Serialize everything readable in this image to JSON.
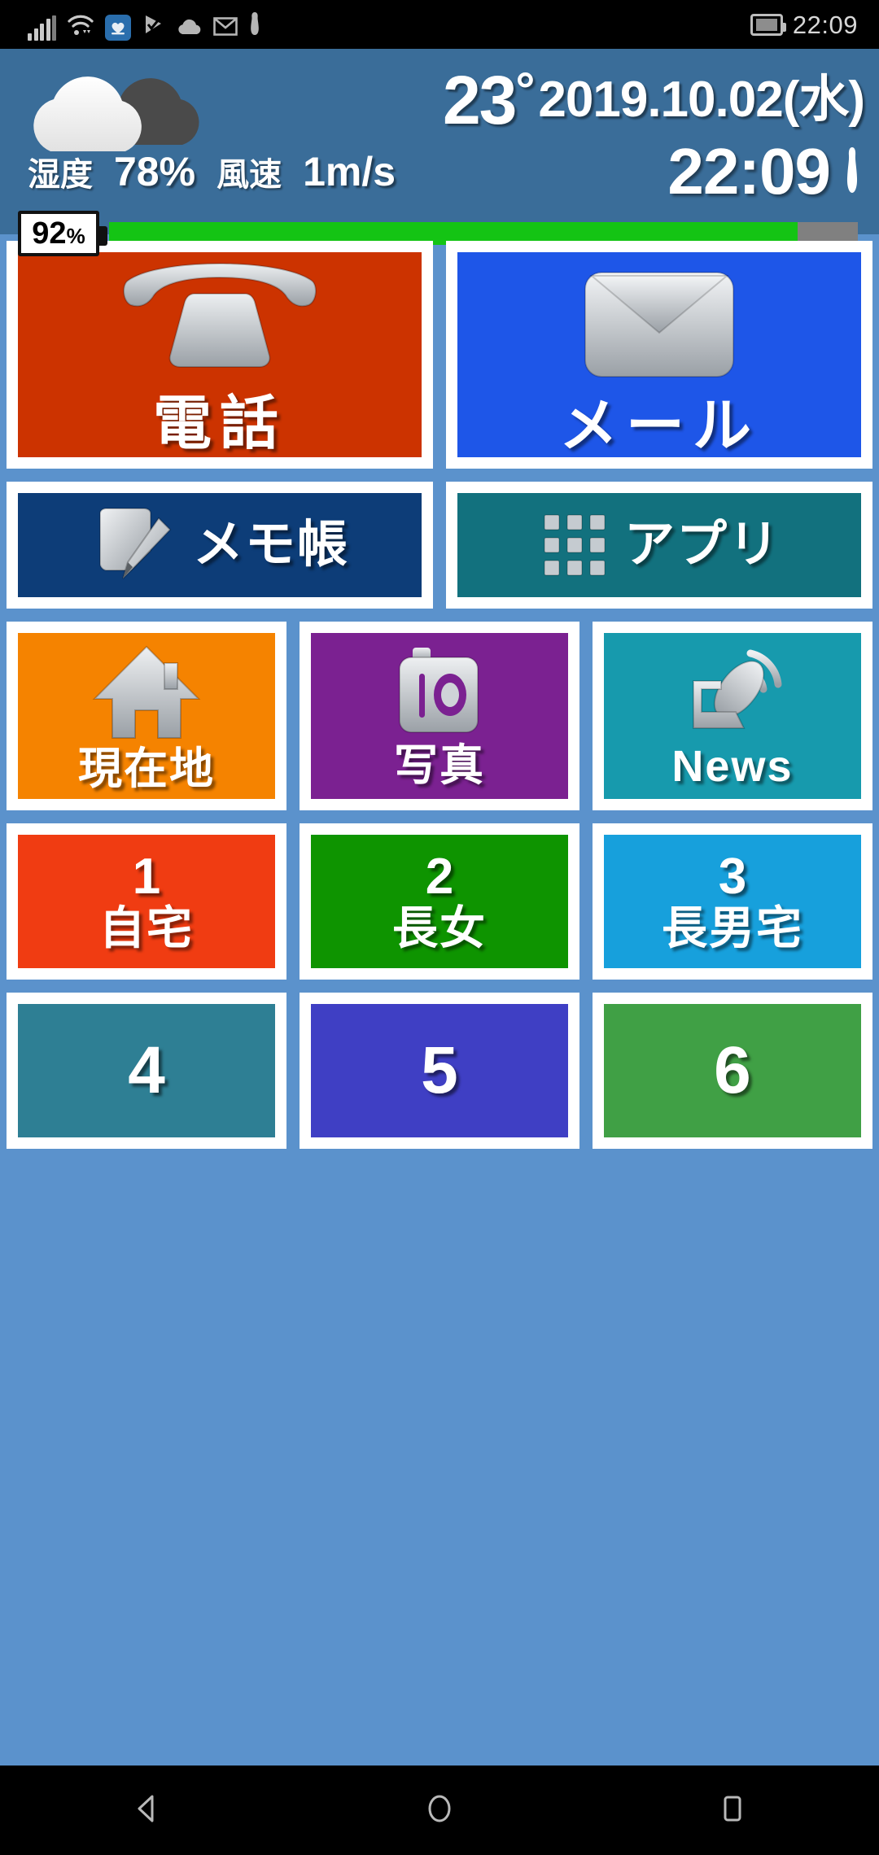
{
  "statusbar": {
    "time": "22:09",
    "icons": [
      "signal-bars-icon",
      "wifi-icon",
      "app-notification-icon",
      "play-store-icon",
      "cloud-icon",
      "email-icon",
      "person-icon"
    ],
    "battery_icon": "battery-icon"
  },
  "weather": {
    "condition_icon": "cloudy-icon",
    "temperature": "23",
    "degree_symbol": "°",
    "date": "2019.10.02(水)",
    "clock": "22:09",
    "person_icon": "person-standing-icon",
    "humidity_label": "湿度",
    "humidity_value": "78%",
    "wind_label": "風速",
    "wind_value": "1m/s"
  },
  "battery": {
    "percent_text": "92",
    "percent_symbol": "%",
    "percent_value": 92,
    "fill_color": "#14c414",
    "track_color": "#808080"
  },
  "tiles": {
    "row1": [
      {
        "label": "電話",
        "icon": "telephone-icon",
        "bg": "#cc3300",
        "name": "tile-phone"
      },
      {
        "label": "メール",
        "icon": "envelope-icon",
        "bg": "#1e56e8",
        "name": "tile-mail"
      }
    ],
    "row2": [
      {
        "label": "メモ帳",
        "icon": "memo-pencil-icon",
        "bg": "#0d3d78",
        "name": "tile-memo"
      },
      {
        "label": "アプリ",
        "icon": "app-grid-icon",
        "bg": "#12717e",
        "name": "tile-apps"
      }
    ],
    "row3": [
      {
        "label": "現在地",
        "icon": "house-icon",
        "bg": "#f58300",
        "name": "tile-location"
      },
      {
        "label": "写真",
        "icon": "camera-icon",
        "bg": "#7b2191",
        "name": "tile-photo"
      },
      {
        "label": "News",
        "icon": "satellite-dish-icon",
        "bg": "#179aad",
        "name": "tile-news"
      }
    ],
    "row4": [
      {
        "number": "1",
        "label": "自宅",
        "bg": "#f03c12",
        "name": "tile-speeddial-1"
      },
      {
        "number": "2",
        "label": "長女",
        "bg": "#0e9400",
        "name": "tile-speeddial-2"
      },
      {
        "number": "3",
        "label": "長男宅",
        "bg": "#17a0dc",
        "name": "tile-speeddial-3"
      }
    ],
    "row5": [
      {
        "number": "4",
        "label": "",
        "bg": "#2e7f94",
        "name": "tile-speeddial-4"
      },
      {
        "number": "5",
        "label": "",
        "bg": "#3f3fc4",
        "name": "tile-speeddial-5"
      },
      {
        "number": "6",
        "label": "",
        "bg": "#40a045",
        "name": "tile-speeddial-6"
      }
    ]
  },
  "navbar": {
    "back": "back-icon",
    "home": "home-icon",
    "recents": "recents-icon"
  },
  "colors": {
    "wallpaper": "#5b92cc",
    "weather_panel": "#3a6d99",
    "tile_frame": "#ffffff"
  }
}
